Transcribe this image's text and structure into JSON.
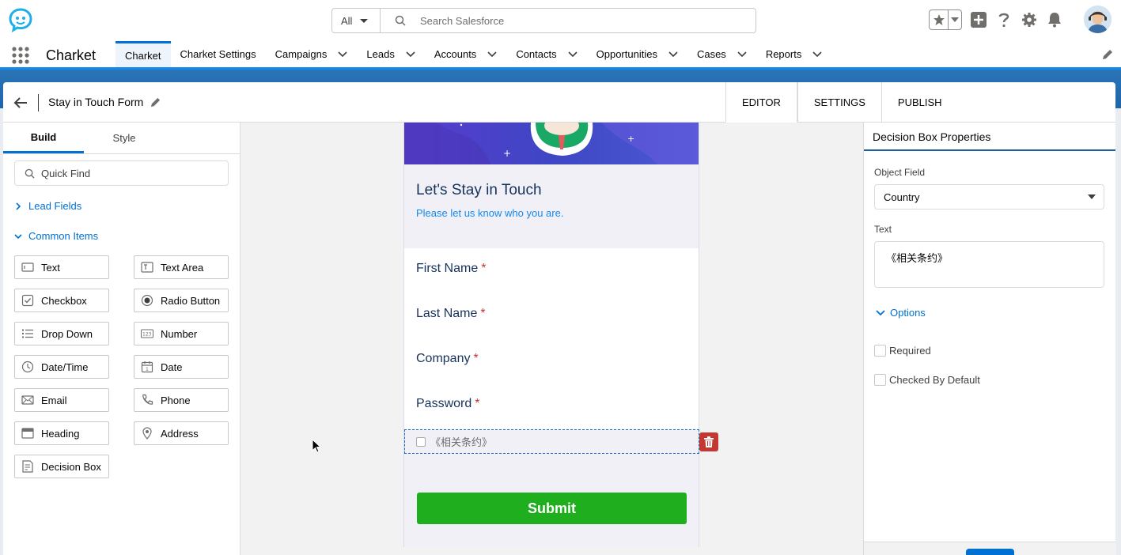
{
  "header": {
    "search_scope": "All",
    "search_placeholder": "Search Salesforce"
  },
  "nav": {
    "app_name": "Charket",
    "items": [
      {
        "label": "Charket",
        "active": true,
        "dropdown": false
      },
      {
        "label": "Charket Settings",
        "active": false,
        "dropdown": false
      },
      {
        "label": "Campaigns",
        "active": false,
        "dropdown": true
      },
      {
        "label": "Leads",
        "active": false,
        "dropdown": true
      },
      {
        "label": "Accounts",
        "active": false,
        "dropdown": true
      },
      {
        "label": "Contacts",
        "active": false,
        "dropdown": true
      },
      {
        "label": "Opportunities",
        "active": false,
        "dropdown": true
      },
      {
        "label": "Cases",
        "active": false,
        "dropdown": true
      },
      {
        "label": "Reports",
        "active": false,
        "dropdown": true
      }
    ]
  },
  "editor": {
    "form_title": "Stay in Touch Form",
    "tabs": [
      {
        "label": "EDITOR",
        "active": true
      },
      {
        "label": "SETTINGS",
        "active": false
      },
      {
        "label": "PUBLISH",
        "active": false
      }
    ]
  },
  "left_panel": {
    "tabs": [
      {
        "label": "Build",
        "active": true
      },
      {
        "label": "Style",
        "active": false
      }
    ],
    "quick_find_placeholder": "Quick Find",
    "lead_fields_label": "Lead Fields",
    "common_items_label": "Common Items",
    "items": [
      {
        "label": "Text",
        "icon": "text-field-icon"
      },
      {
        "label": "Text Area",
        "icon": "text-area-icon"
      },
      {
        "label": "Checkbox",
        "icon": "checkbox-icon"
      },
      {
        "label": "Radio Button",
        "icon": "radio-button-icon"
      },
      {
        "label": "Drop Down",
        "icon": "list-icon"
      },
      {
        "label": "Number",
        "icon": "number-icon"
      },
      {
        "label": "Date/Time",
        "icon": "clock-icon"
      },
      {
        "label": "Date",
        "icon": "calendar-icon"
      },
      {
        "label": "Email",
        "icon": "email-icon"
      },
      {
        "label": "Phone",
        "icon": "phone-icon"
      },
      {
        "label": "Heading",
        "icon": "heading-icon"
      },
      {
        "label": "Address",
        "icon": "location-pin-icon"
      },
      {
        "label": "Decision Box",
        "icon": "decision-box-icon"
      }
    ]
  },
  "form": {
    "title": "Let's Stay in Touch",
    "subtitle": "Please let us know who you are.",
    "fields": [
      {
        "label": "First Name",
        "required_mark": "*"
      },
      {
        "label": "Last Name",
        "required_mark": "*"
      },
      {
        "label": "Company",
        "required_mark": "*"
      },
      {
        "label": "Password",
        "required_mark": "*"
      }
    ],
    "decision_text": "《相关条约》",
    "submit_label": "Submit"
  },
  "right_panel": {
    "title": "Decision Box Properties",
    "object_field_label": "Object Field",
    "object_field_value": "Country",
    "text_label": "Text",
    "text_value": "《相关条约》",
    "options_label": "Options",
    "required_label": "Required",
    "checked_default_label": "Checked By Default"
  },
  "colors": {
    "brand_blue": "#0070d2",
    "submit_green": "#1eae1e",
    "delete_red": "#c23934"
  }
}
